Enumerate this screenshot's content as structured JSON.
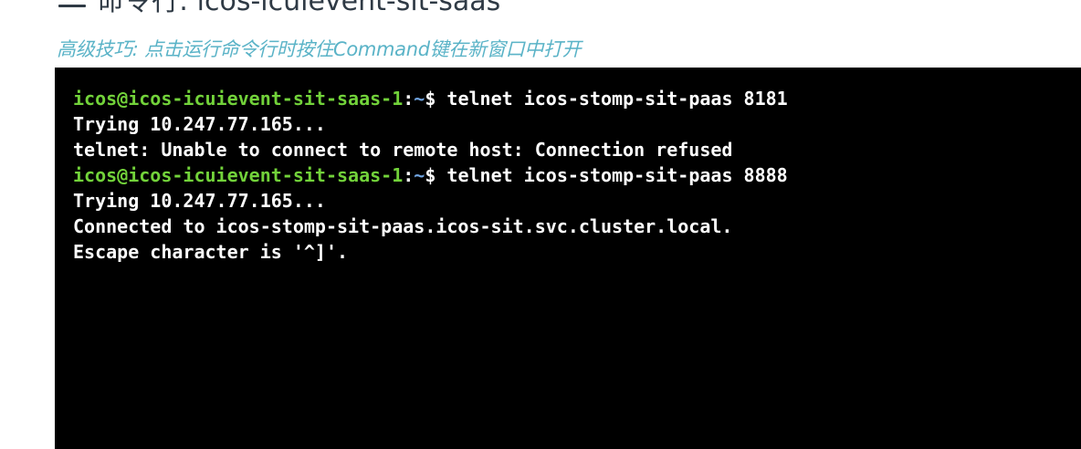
{
  "header": {
    "title": "命令行: icos-icuievent-sit-saas",
    "icon": "terminal-lines-icon"
  },
  "tip": {
    "text": "高级技巧: 点击运行命令行时按住Command键在新窗口中打开"
  },
  "terminal": {
    "colors": {
      "background": "#000000",
      "prompt_user": "#72d23a",
      "prompt_path": "#6fa3df",
      "text": "#ffffff"
    },
    "lines": [
      {
        "type": "prompt",
        "user_host": "icos@icos-icuievent-sit-saas-1",
        "sep": ":",
        "path": "~",
        "symbol": "$ ",
        "command": "telnet icos-stomp-sit-paas 8181"
      },
      {
        "type": "output",
        "text": "Trying 10.247.77.165..."
      },
      {
        "type": "output",
        "text": "telnet: Unable to connect to remote host: Connection refused"
      },
      {
        "type": "prompt",
        "user_host": "icos@icos-icuievent-sit-saas-1",
        "sep": ":",
        "path": "~",
        "symbol": "$ ",
        "command": "telnet icos-stomp-sit-paas 8888"
      },
      {
        "type": "output",
        "text": "Trying 10.247.77.165..."
      },
      {
        "type": "output",
        "text": "Connected to icos-stomp-sit-paas.icos-sit.svc.cluster.local."
      },
      {
        "type": "output",
        "text": "Escape character is '^]'."
      }
    ]
  }
}
